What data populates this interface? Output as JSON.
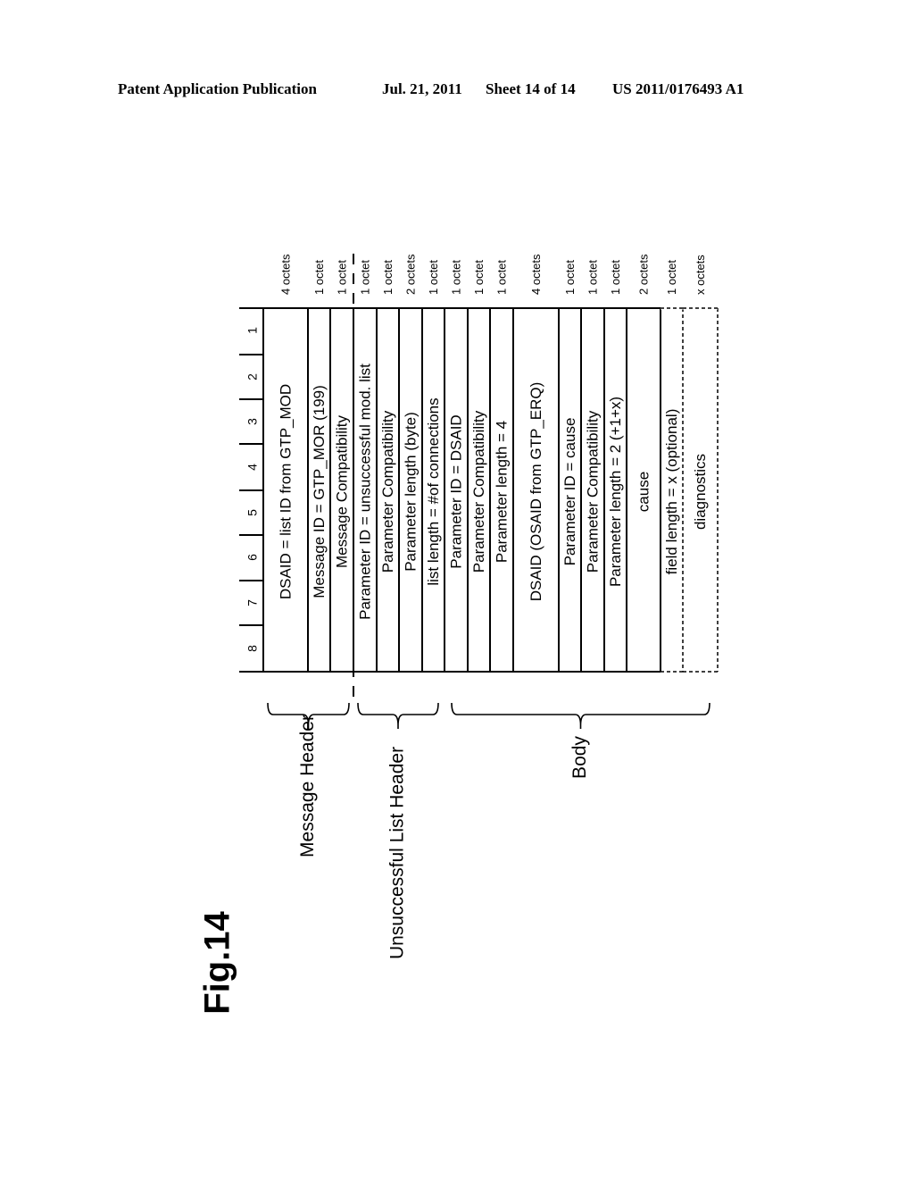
{
  "header": {
    "publication": "Patent Application Publication",
    "date": "Jul. 21, 2011",
    "sheet": "Sheet 14 of 14",
    "number": "US 2011/0176493 A1"
  },
  "figure": {
    "label": "Fig.14",
    "bit_numbers": [
      "1",
      "2",
      "3",
      "4",
      "5",
      "6",
      "7",
      "8"
    ],
    "fields": [
      {
        "text": "DSAID = list ID from GTP_MOD",
        "size": "4 octets",
        "optional": false
      },
      {
        "text": "Message ID = GTP_MOR (199)",
        "size": "1 octet",
        "optional": false
      },
      {
        "text": "Message Compatibility",
        "size": "1 octet",
        "optional": false
      },
      {
        "text": "Parameter ID = unsuccessful mod. list",
        "size": "1 octet",
        "optional": false
      },
      {
        "text": "Parameter Compatibility",
        "size": "1 octet",
        "optional": false
      },
      {
        "text": "Parameter length (byte)",
        "size": "2 octets",
        "optional": false
      },
      {
        "text": "list length = #of connections",
        "size": "1 octet",
        "optional": false
      },
      {
        "text": "Parameter ID = DSAID",
        "size": "1 octet",
        "optional": false
      },
      {
        "text": "Parameter Compatibility",
        "size": "1 octet",
        "optional": false
      },
      {
        "text": "Parameter length = 4",
        "size": "1 octet",
        "optional": false
      },
      {
        "text": "DSAID (OSAID from GTP_ERQ)",
        "size": "4 octets",
        "optional": false
      },
      {
        "text": "Parameter ID = cause",
        "size": "1 octet",
        "optional": false
      },
      {
        "text": "Parameter Compatibility",
        "size": "1 octet",
        "optional": false
      },
      {
        "text": "Parameter length = 2 (+1+x)",
        "size": "1 octet",
        "optional": false
      },
      {
        "text": "cause",
        "size": "2 octets",
        "optional": false
      },
      {
        "text": "field length = x (optional)",
        "size": "1 octet",
        "optional": true
      },
      {
        "text": "diagnostics",
        "size": "x octets",
        "optional": true
      }
    ],
    "groups": [
      {
        "label": "Message Header",
        "from_field": 0,
        "to_field": 2
      },
      {
        "label": "Unsuccessful List Header",
        "from_field": 3,
        "to_field": 6
      },
      {
        "label": "Body",
        "from_field": 7,
        "to_field": 16
      }
    ]
  }
}
